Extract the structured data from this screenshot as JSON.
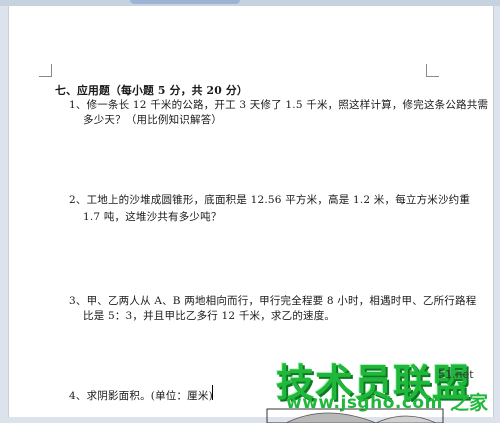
{
  "document": {
    "section_title": "七、应用题（每小题 5 分，共 20 分）",
    "questions": [
      {
        "line1": "1、修一条长 12 千米的公路，开工 3 天修了 1.5 千米，照这样计算，修完这条公路共需",
        "line2": "多少天？（用比例知识解答）"
      },
      {
        "line1": "2、工地上的沙堆成圆锥形，底面积是 12.56 平方米，高是 1.2 米，每立方米沙约重",
        "line2": "1.7 吨，这堆沙共有多少吨？"
      },
      {
        "line1": "3、甲、乙两人从 A、B 两地相向而行，甲行完全程要 8 小时，相遇时甲、乙所行路程",
        "line2": "比是 5：3，并且甲比乙多行 12 千米，求乙的速度。"
      },
      {
        "line1": "4、求阴影面积。(单位：厘米)"
      }
    ]
  },
  "watermark": {
    "brand": "技术员联盟",
    "url": "www.jsgho.com",
    "domain_fragment": "51.net",
    "home_label": "之家"
  },
  "colors": {
    "watermark_green": "#1fb83a",
    "figure_shade": "#b8b8b8"
  }
}
